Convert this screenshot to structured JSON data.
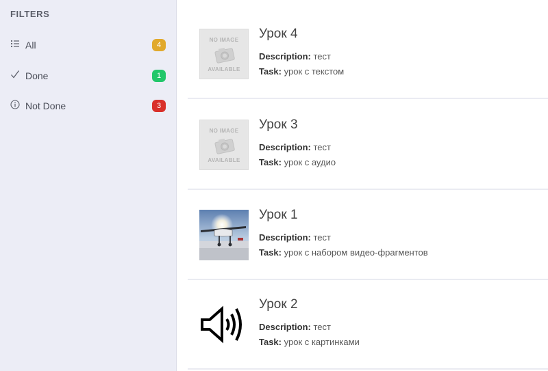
{
  "sidebar": {
    "title": "FILTERS",
    "filters": [
      {
        "label": "All",
        "count": "4",
        "icon": "list-icon",
        "badge_color": "#e1a92c"
      },
      {
        "label": "Done",
        "count": "1",
        "icon": "check-icon",
        "badge_color": "#22c76a"
      },
      {
        "label": "Not Done",
        "count": "3",
        "icon": "info-icon",
        "badge_color": "#d9302a"
      }
    ]
  },
  "lessons": [
    {
      "title": "Урок 4",
      "description_label": "Description:",
      "description": "тест",
      "task_label": "Task:",
      "task": "урок с текстом",
      "thumb": "no-image",
      "noimage_top": "NO IMAGE",
      "noimage_bottom": "AVAILABLE"
    },
    {
      "title": "Урок 3",
      "description_label": "Description:",
      "description": "тест",
      "task_label": "Task:",
      "task": "урок с аудио",
      "thumb": "no-image",
      "noimage_top": "NO IMAGE",
      "noimage_bottom": "AVAILABLE"
    },
    {
      "title": "Урок 1",
      "description_label": "Description:",
      "description": "тест",
      "task_label": "Task:",
      "task": "урок с набором видео-фрагментов",
      "thumb": "airplane-photo"
    },
    {
      "title": "Урок 2",
      "description_label": "Description:",
      "description": "тест",
      "task_label": "Task:",
      "task": "урок с картинками",
      "thumb": "speaker-icon"
    }
  ]
}
